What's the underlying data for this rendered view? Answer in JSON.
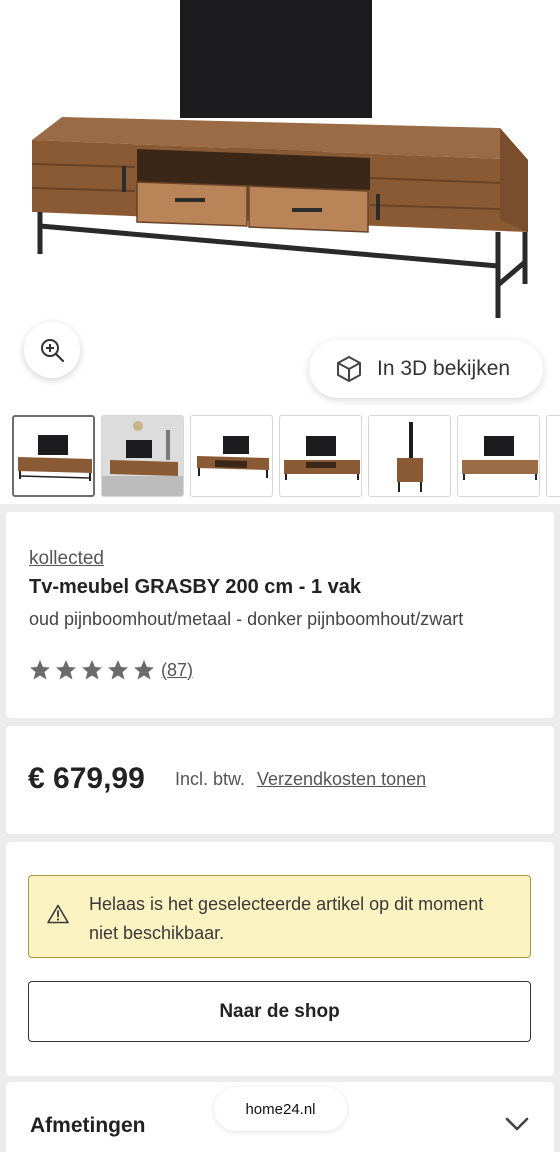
{
  "gallery": {
    "view3d_label": "In 3D bekijken",
    "thumbnails": [
      "tv-meubel-front",
      "tv-meubel-interieur",
      "tv-meubel-open",
      "tv-meubel-front-2",
      "tv-meubel-zijkant",
      "tv-meubel-achter"
    ]
  },
  "product": {
    "brand": "kollected",
    "title": "Tv-meubel GRASBY 200 cm - 1 vak",
    "subtitle": "oud pijnboomhout/metaal - donker pijnboomhout/zwart",
    "rating": 5,
    "review_count": "(87)"
  },
  "pricing": {
    "price": "€ 679,99",
    "vat_label": "Incl. btw.",
    "shipping_link": "Verzendkosten tonen"
  },
  "availability": {
    "notice": "Helaas is het geselecteerde artikel op dit moment niet beschikbaar.",
    "shop_button": "Naar de shop"
  },
  "dimensions": {
    "title": "Afmetingen"
  },
  "browser": {
    "domain": "home24.nl"
  },
  "colors": {
    "notice_bg": "#fbf3c1",
    "star": "#6b6b6b",
    "wood": "#8a5a35"
  }
}
